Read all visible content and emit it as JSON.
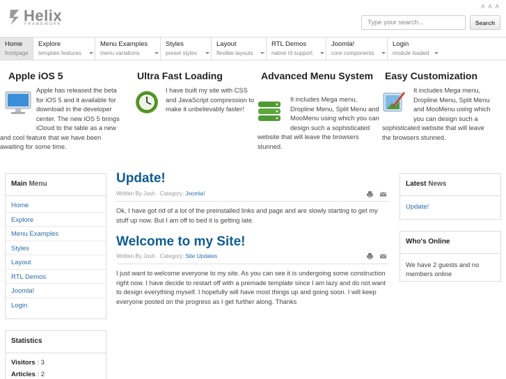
{
  "header": {
    "logo_name": "Helix",
    "logo_sub": "FRAMEWORK",
    "font_tools": [
      "A",
      "A",
      "A"
    ],
    "search_placeholder": "Type your search...",
    "search_button": "Search"
  },
  "nav": [
    {
      "label": "Home",
      "sub": "frontpage",
      "active": true
    },
    {
      "label": "Explore",
      "sub": "template features"
    },
    {
      "label": "Menu Examples",
      "sub": "menu variations"
    },
    {
      "label": "Styles",
      "sub": "preset styles"
    },
    {
      "label": "Layout",
      "sub": "flexible layouts"
    },
    {
      "label": "RTL Demos",
      "sub": "native rtl support"
    },
    {
      "label": "Joomla!",
      "sub": "core components"
    },
    {
      "label": "Login",
      "sub": "module loaded"
    }
  ],
  "features": [
    {
      "title": "Apple iOS 5",
      "icon": "monitor-icon",
      "text": "Apple has released the beta for iOS 5 and it available for download in the developer center.  The new iOS 5 brings iCloud to the table as a new and cool feature that we have been awaiting for some time."
    },
    {
      "title": "Ultra Fast Loading",
      "icon": "clock-icon",
      "text": "I have built my site with CSS and JavaScript compression to make it unbelievably faster!"
    },
    {
      "title": "Advanced Menu System",
      "icon": "server-icon",
      "text": "It includes Mega menu, Dropline Menu, Split Menu and MooMenu using which you can design such a sophisticated website that will leave the browsers stunned."
    },
    {
      "title": "Easy Customization",
      "icon": "paintbrush-icon",
      "text": "It includes Mega menu, Dropline Menu, Split Menu and MooMenu using which you can design such a sophisticated website that will leave the browsers stunned."
    }
  ],
  "main_menu": {
    "title_a": "Main",
    "title_b": "Menu",
    "items": [
      "Home",
      "Explore",
      "Menu Examples",
      "Styles",
      "Layout",
      "RTL Demos",
      "Joomla!",
      "Login"
    ]
  },
  "statistics": {
    "title": "Statistics",
    "visitors_label": "Visitors",
    "visitors_value": ": 3",
    "articles_label": "Articles",
    "articles_value": ": 2"
  },
  "articles": [
    {
      "title": "Update!",
      "author": "Written By Josh",
      "category_label": "Category:",
      "category": "Joomla!",
      "text": "Ok, I have got rid of a lot of the preinstalled links and page and are slowly starting to get my stuff up now.  But I am off to bed it is getting late."
    },
    {
      "title": "Welcome to my Site!",
      "author": "Written By Josh",
      "category_label": "Category:",
      "category": "Site Updates",
      "text": "I just want to welcome everyone to my site.  As you can see it is undergoing some construction right now.  I have decide to restart off with a premade template since I am lazy and do not want to design everything myself.  I hopefully will have most things up and going soon.  I will keep everyone posted on the progress as I get further along.  Thanks"
    }
  ],
  "latest_news": {
    "title_a": "Latest",
    "title_b": "News",
    "link": "Update!"
  },
  "whos_online": {
    "title": "Who's Online",
    "text": "We have 2 guests and no members online"
  },
  "colors": {
    "link": "#2a6da8",
    "article_title": "#0f5d93",
    "border": "#dddddd"
  }
}
